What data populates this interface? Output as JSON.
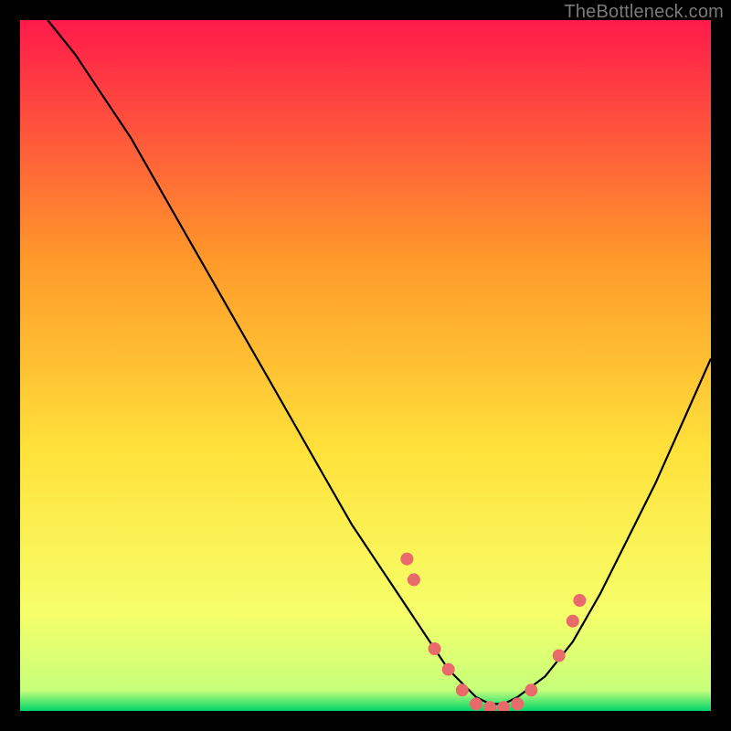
{
  "watermark": "TheBottleneck.com",
  "chart_data": {
    "type": "line",
    "title": "",
    "xlabel": "",
    "ylabel": "",
    "xlim": [
      0,
      100
    ],
    "ylim": [
      0,
      100
    ],
    "background_gradient": {
      "top": "#ff1a4b",
      "mid1": "#ff7f2a",
      "mid2": "#ffe13a",
      "low": "#f6ff6a",
      "bottom": "#00d66a"
    },
    "curve": {
      "name": "bottleneck-curve",
      "color": "#000000",
      "x": [
        4,
        8,
        12,
        16,
        20,
        24,
        28,
        32,
        36,
        40,
        44,
        48,
        52,
        56,
        58,
        60,
        62,
        64,
        66,
        68,
        70,
        72,
        76,
        80,
        84,
        88,
        92,
        96,
        100
      ],
      "y": [
        100,
        95,
        89,
        83,
        76,
        69,
        62,
        55,
        48,
        41,
        34,
        27,
        21,
        15,
        12,
        9,
        6,
        4,
        2,
        1,
        1,
        2,
        5,
        10,
        17,
        25,
        33,
        42,
        51
      ]
    },
    "markers": {
      "name": "sample-points",
      "color": "#e86a6a",
      "radius": 7,
      "points": [
        {
          "x": 56,
          "y": 22
        },
        {
          "x": 57,
          "y": 19
        },
        {
          "x": 60,
          "y": 9
        },
        {
          "x": 62,
          "y": 6
        },
        {
          "x": 64,
          "y": 3
        },
        {
          "x": 66,
          "y": 1
        },
        {
          "x": 68,
          "y": 0.5
        },
        {
          "x": 70,
          "y": 0.5
        },
        {
          "x": 72,
          "y": 1
        },
        {
          "x": 74,
          "y": 3
        },
        {
          "x": 78,
          "y": 8
        },
        {
          "x": 80,
          "y": 13
        },
        {
          "x": 81,
          "y": 16
        }
      ]
    }
  }
}
